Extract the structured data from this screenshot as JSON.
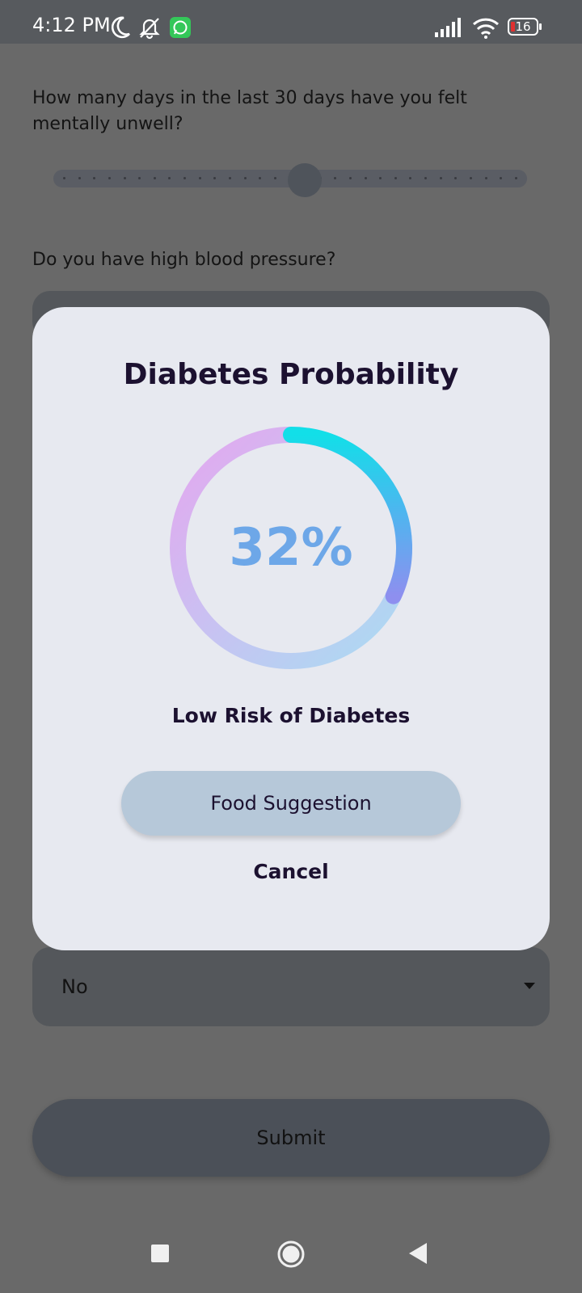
{
  "status_bar": {
    "time": "4:12 PM",
    "battery": "16",
    "icons": [
      "moon-icon",
      "bell-off-icon",
      "whatsapp-icon",
      "signal-icon",
      "wifi-icon",
      "battery-icon"
    ]
  },
  "form": {
    "question_mental": "How many days in the last 30 days have you felt mentally unwell?",
    "question_bp": "Do you have high blood pressure?",
    "dropdown_value": "No",
    "submit_label": "Submit"
  },
  "dialog": {
    "title": "Diabetes Probability",
    "percent_text": "32%",
    "percent_value": 32,
    "risk_label": "Low Risk of Diabetes",
    "food_button_label": "Food Suggestion",
    "cancel_label": "Cancel",
    "colors": {
      "gauge_start": "#12dfe8",
      "gauge_end": "#8e8fef",
      "track_light": "#e4a7ef",
      "value_text": "#6da7e8"
    }
  },
  "nav": {
    "icons": [
      "recents-icon",
      "home-icon",
      "back-icon"
    ]
  }
}
